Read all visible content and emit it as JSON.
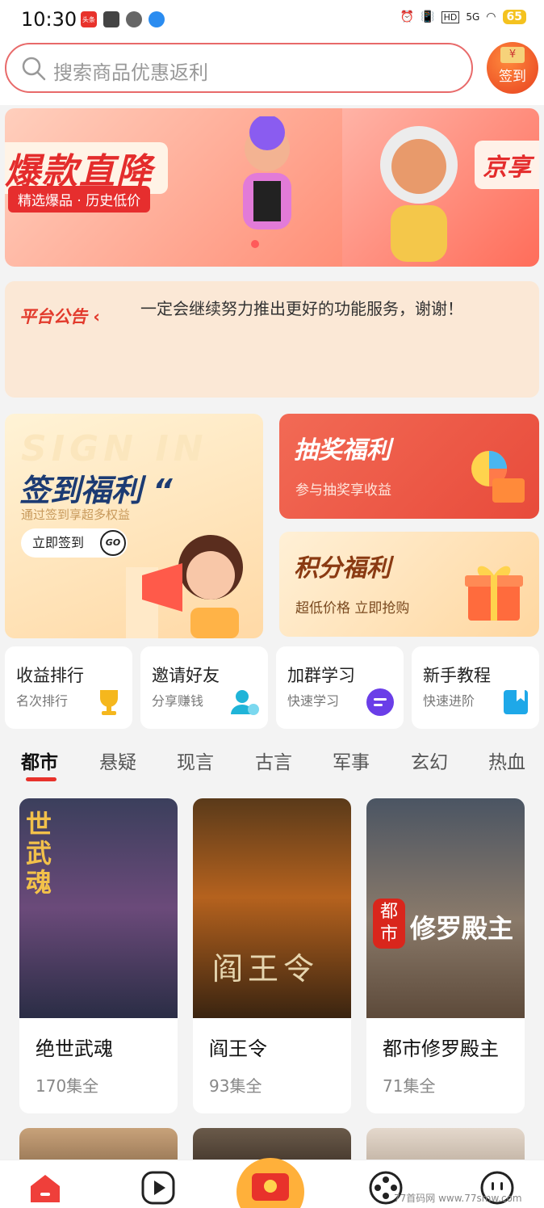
{
  "status_bar": {
    "time": "10:30",
    "network": "5G",
    "battery": "65",
    "hd_label": "HD"
  },
  "search": {
    "placeholder": "搜索商品优惠返利"
  },
  "checkin_badge": {
    "label": "签到",
    "symbol": "¥"
  },
  "banner": {
    "slides": [
      {
        "title": "爆款直降",
        "subtitle": "精选爆品 · 历史低价"
      },
      {
        "title": "京享"
      }
    ]
  },
  "notice": {
    "label": "平台公告",
    "text": "一定会继续努力推出更好的功能服务，谢谢！"
  },
  "promos": {
    "sign": {
      "bg_text": "SIGN IN",
      "title": "签到福利 “",
      "subtitle": "通过签到享超多权益",
      "button_label": "立即签到",
      "go_label": "GO"
    },
    "lottery": {
      "title": "抽奖福利",
      "subtitle": "参与抽奖享收益"
    },
    "points": {
      "title": "积分福利",
      "subtitle": "超低价格 立即抢购"
    }
  },
  "quick_entries": [
    {
      "title": "收益排行",
      "subtitle": "名次排行",
      "icon": "trophy-icon",
      "color": "#f5b71d"
    },
    {
      "title": "邀请好友",
      "subtitle": "分享赚钱",
      "icon": "user-add-icon",
      "color": "#1fb4d8"
    },
    {
      "title": "加群学习",
      "subtitle": "快速学习",
      "icon": "chat-group-icon",
      "color": "#6a3ee8"
    },
    {
      "title": "新手教程",
      "subtitle": "快速进阶",
      "icon": "bookmark-icon",
      "color": "#1ea8e8"
    }
  ],
  "tabs": [
    "都市",
    "悬疑",
    "现言",
    "古言",
    "军事",
    "玄幻",
    "热血"
  ],
  "active_tab": 0,
  "dramas": [
    {
      "title": "绝世武魂",
      "episodes": "170集全",
      "poster_text": "世武魂"
    },
    {
      "title": "阎王令",
      "episodes": "93集全",
      "poster_text": "阎王令"
    },
    {
      "title": "都市修罗殿主",
      "episodes": "71集全",
      "poster_text": "修罗殿主",
      "poster_tag": "都市"
    }
  ],
  "bottom_nav": [
    {
      "icon": "home-icon",
      "active": true
    },
    {
      "icon": "play-icon"
    },
    {
      "icon": "red-packet-icon"
    },
    {
      "icon": "film-reel-icon"
    },
    {
      "icon": "profile-icon"
    }
  ],
  "watermark": "77首码网 www.77smw.com",
  "colors": {
    "brand_red": "#e8322b",
    "notice_bg": "#fbe8d6",
    "search_border": "#e86a6a"
  }
}
